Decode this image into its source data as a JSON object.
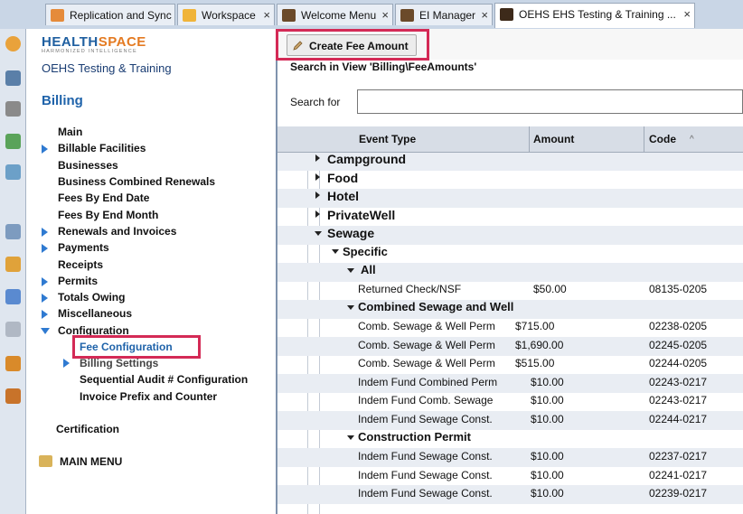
{
  "tabs": [
    {
      "label": "Replication and Sync",
      "close": ""
    },
    {
      "label": "Workspace",
      "close": "×"
    },
    {
      "label": "Welcome Menu",
      "close": "×"
    },
    {
      "label": "EI Manager",
      "close": "×"
    },
    {
      "label": "OEHS EHS Testing & Training ...",
      "close": "×"
    }
  ],
  "sidebar": {
    "logo_main": "HEALTH",
    "logo_accent": "SPACE",
    "logo_tag": "HARMONIZED INTELLIGENCE",
    "org_name": "OEHS Testing & Training",
    "section_title": "Billing",
    "items": [
      "Main",
      "Billable Facilities",
      "Businesses",
      "Business Combined Renewals",
      "Fees By End Date",
      "Fees By End Month",
      "Renewals and Invoices",
      "Payments",
      "Receipts",
      "Permits",
      "Totals Owing",
      "Miscellaneous",
      "Configuration",
      "Fee Configuration",
      "Billing Settings",
      "Sequential Audit # Configuration",
      "Invoice Prefix and Counter",
      "Certification",
      "MAIN MENU"
    ]
  },
  "toolbar": {
    "create_label": "Create Fee Amount"
  },
  "search": {
    "title": "Search in View 'Billing\\FeeAmounts'",
    "label": "Search for",
    "value": ""
  },
  "grid": {
    "columns": [
      "Event Type",
      "Amount",
      "Code"
    ],
    "sort_indicator": "^",
    "rows": [
      {
        "label": "Campground",
        "amount": "",
        "code": ""
      },
      {
        "label": "Food",
        "amount": "",
        "code": ""
      },
      {
        "label": "Hotel",
        "amount": "",
        "code": ""
      },
      {
        "label": "PrivateWell",
        "amount": "",
        "code": ""
      },
      {
        "label": "Sewage",
        "amount": "",
        "code": ""
      },
      {
        "label": "Specific",
        "amount": "",
        "code": ""
      },
      {
        "label": "All",
        "amount": "",
        "code": ""
      },
      {
        "label": "Returned Check/NSF",
        "amount": "$50.00",
        "code": "08135-0205"
      },
      {
        "label": "Combined Sewage and Well",
        "amount": "",
        "code": ""
      },
      {
        "label": "Comb. Sewage & Well Perm",
        "amount": "$715.00",
        "code": "02238-0205"
      },
      {
        "label": "Comb. Sewage & Well Perm",
        "amount": "$1,690.00",
        "code": "02245-0205"
      },
      {
        "label": "Comb. Sewage & Well Perm",
        "amount": "$515.00",
        "code": "02244-0205"
      },
      {
        "label": "Indem Fund Combined Perm",
        "amount": "$10.00",
        "code": "02243-0217"
      },
      {
        "label": "Indem Fund Comb. Sewage",
        "amount": "$10.00",
        "code": "02243-0217"
      },
      {
        "label": "Indem Fund Sewage Const.",
        "amount": "$10.00",
        "code": "02244-0217"
      },
      {
        "label": "Construction Permit",
        "amount": "",
        "code": ""
      },
      {
        "label": "Indem Fund Sewage Const.",
        "amount": "$10.00",
        "code": "02237-0217"
      },
      {
        "label": "Indem Fund Sewage Const.",
        "amount": "$10.00",
        "code": "02241-0217"
      },
      {
        "label": "Indem Fund Sewage Const.",
        "amount": "$10.00",
        "code": "02239-0217"
      }
    ]
  },
  "colors": {
    "highlight": "#d42a56",
    "accent": "#2f7ad1",
    "link": "#1f63aa"
  }
}
